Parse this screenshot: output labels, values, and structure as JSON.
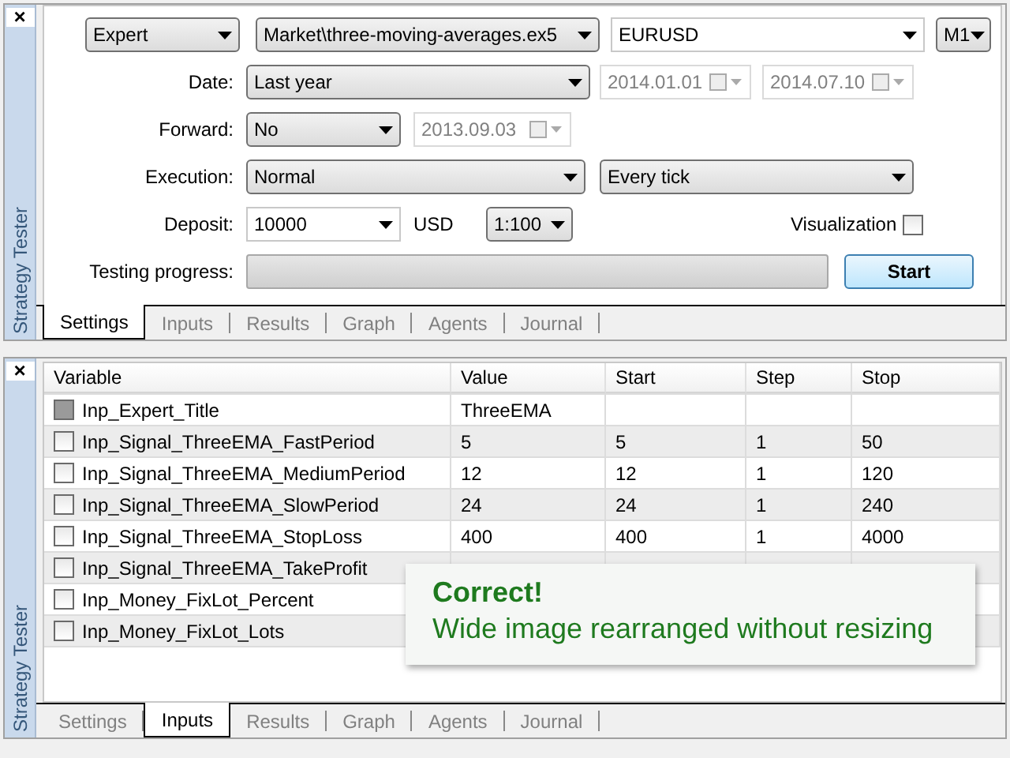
{
  "settings_panel": {
    "side_title": "Strategy Tester",
    "close": "×",
    "top_row": [
      {
        "kind": "list",
        "value": "Expert"
      },
      {
        "kind": "list",
        "value": "Market\\three-moving-averages.ex5"
      },
      {
        "kind": "edit",
        "value": "EURUSD"
      },
      {
        "kind": "list",
        "value": "M1"
      }
    ],
    "date": {
      "label": "Date:",
      "value": "Last year",
      "from": {
        "value": "2014.01.01",
        "disabled": true
      },
      "to": {
        "value": "2014.07.10",
        "disabled": true
      }
    },
    "forward": {
      "label": "Forward:",
      "value": "No",
      "date": {
        "value": "2013.09.03",
        "disabled": true
      }
    },
    "execution": {
      "label": "Execution:",
      "value": "Normal",
      "model": "Every tick"
    },
    "deposit": {
      "label": "Deposit:",
      "value": "10000",
      "currency": "USD",
      "leverage": "1:100"
    },
    "visualization": {
      "label": "Visualization",
      "checked": false
    },
    "progress": {
      "label": "Testing progress:",
      "level": 0
    },
    "start_button": "Start",
    "tabs": [
      {
        "label": "Settings",
        "selected": true
      },
      {
        "label": "Inputs",
        "selected": false
      },
      {
        "label": "Results",
        "selected": false
      },
      {
        "label": "Graph",
        "selected": false
      },
      {
        "label": "Agents",
        "selected": false
      },
      {
        "label": "Journal",
        "selected": false
      }
    ]
  },
  "inputs_panel": {
    "side_title": "Strategy Tester",
    "close": "×",
    "columns": [
      "Variable",
      "Value",
      "Start",
      "Step",
      "Stop"
    ],
    "rows": [
      {
        "checked": false,
        "disabled": true,
        "cells": [
          "Inp_Expert_Title",
          "ThreeEMA"
        ]
      },
      {
        "checked": false,
        "disabled": false,
        "cells": [
          "Inp_Signal_ThreeEMA_FastPeriod",
          "5",
          "5",
          "1",
          "50"
        ]
      },
      {
        "checked": false,
        "disabled": false,
        "cells": [
          "Inp_Signal_ThreeEMA_MediumPeriod",
          "12",
          "12",
          "1",
          "120"
        ]
      },
      {
        "checked": false,
        "disabled": false,
        "cells": [
          "Inp_Signal_ThreeEMA_SlowPeriod",
          "24",
          "24",
          "1",
          "240"
        ]
      },
      {
        "checked": false,
        "disabled": false,
        "cells": [
          "Inp_Signal_ThreeEMA_StopLoss",
          "400",
          "400",
          "1",
          "4000"
        ]
      },
      {
        "checked": false,
        "disabled": false,
        "cells": [
          "Inp_Signal_ThreeEMA_TakeProfit"
        ]
      },
      {
        "checked": false,
        "disabled": false,
        "cells": [
          "Inp_Money_FixLot_Percent"
        ]
      },
      {
        "checked": false,
        "disabled": false,
        "cells": [
          "Inp_Money_FixLot_Lots"
        ]
      }
    ],
    "tabs": [
      {
        "label": "Settings",
        "selected": false
      },
      {
        "label": "Inputs",
        "selected": true
      },
      {
        "label": "Results",
        "selected": false
      },
      {
        "label": "Graph",
        "selected": false
      },
      {
        "label": "Agents",
        "selected": false
      },
      {
        "label": "Journal",
        "selected": false
      }
    ]
  },
  "notice": {
    "title": "Correct!",
    "message": "Wide image rearranged without resizing"
  }
}
